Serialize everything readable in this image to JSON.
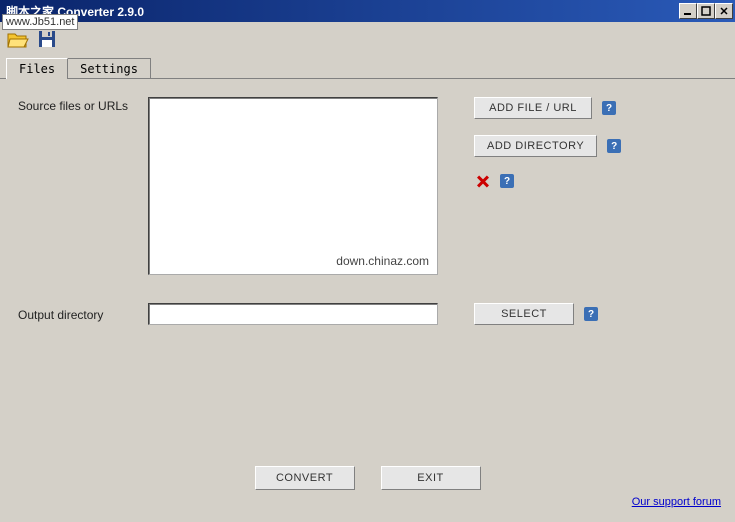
{
  "window": {
    "title": "脚本之家 Converter 2.9.0"
  },
  "watermark_overlay": "www.Jb51.net",
  "tabs": {
    "files": "Files",
    "settings": "Settings"
  },
  "labels": {
    "source": "Source files or URLs",
    "output": "Output directory"
  },
  "listbox": {
    "watermark": "down.chinaz.com"
  },
  "buttons": {
    "add_file": "ADD FILE / URL",
    "add_directory": "ADD DIRECTORY",
    "select": "SELECT",
    "convert": "CONVERT",
    "exit": "EXIT"
  },
  "help_glyph": "?",
  "output_value": "",
  "footer_link": "Our support forum"
}
